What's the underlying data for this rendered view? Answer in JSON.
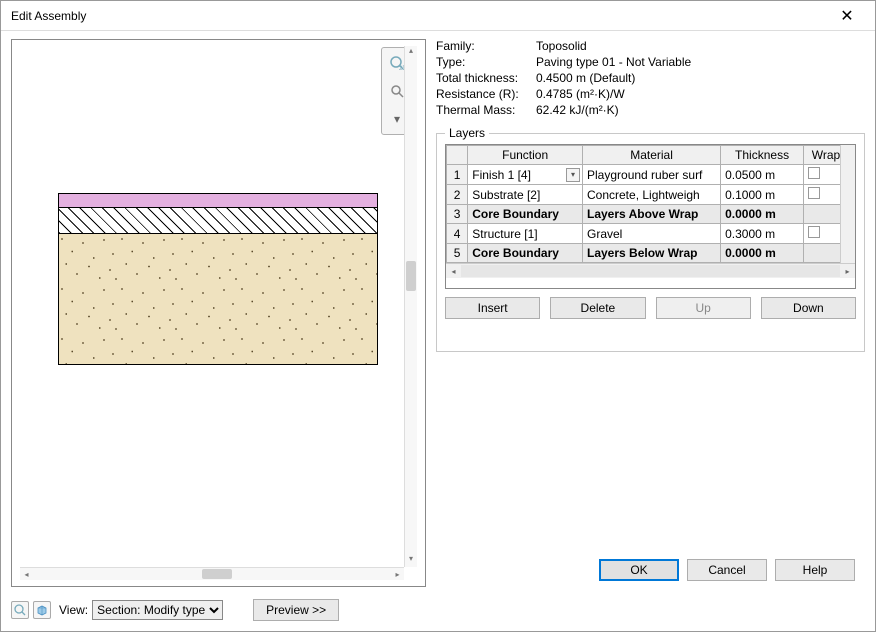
{
  "window": {
    "title": "Edit Assembly"
  },
  "properties": {
    "family_label": "Family:",
    "family_value": "Toposolid",
    "type_label": "Type:",
    "type_value": "Paving type 01 - Not Variable",
    "thickness_label": "Total thickness:",
    "thickness_value": "0.4500 m (Default)",
    "resistance_label": "Resistance (R):",
    "resistance_value": "0.4785 (m²·K)/W",
    "mass_label": "Thermal Mass:",
    "mass_value": "62.42 kJ/(m²·K)"
  },
  "group": {
    "label": "Layers"
  },
  "headers": {
    "function": "Function",
    "material": "Material",
    "thickness": "Thickness",
    "wraps": "Wraps"
  },
  "rows": {
    "r1": {
      "n": "1",
      "function": "Finish 1 [4]",
      "material": "Playground ruber surf",
      "thickness": "0.0500 m"
    },
    "r2": {
      "n": "2",
      "function": "Substrate [2]",
      "material": "Concrete, Lightweigh",
      "thickness": "0.1000 m"
    },
    "r3": {
      "n": "3",
      "function": "Core Boundary",
      "material": "Layers Above Wrap",
      "thickness": "0.0000 m"
    },
    "r4": {
      "n": "4",
      "function": "Structure [1]",
      "material": "Gravel",
      "thickness": "0.3000 m"
    },
    "r5": {
      "n": "5",
      "function": "Core Boundary",
      "material": "Layers Below Wrap",
      "thickness": "0.0000 m"
    }
  },
  "buttons": {
    "insert": "Insert",
    "delete": "Delete",
    "up": "Up",
    "down": "Down",
    "ok": "OK",
    "cancel": "Cancel",
    "help": "Help",
    "preview": "Preview >>"
  },
  "view": {
    "label": "View:",
    "selected": "Section: Modify type"
  }
}
